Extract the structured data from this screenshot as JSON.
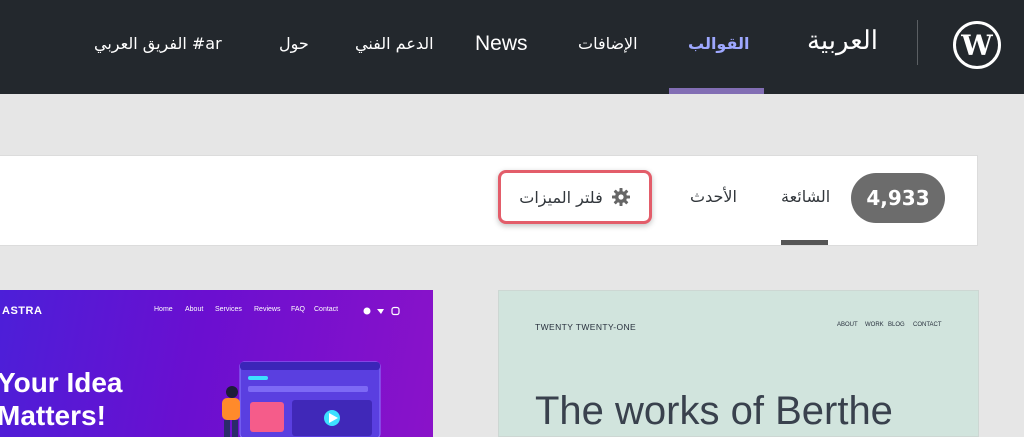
{
  "header": {
    "site_title": "العربية",
    "nav": [
      {
        "label": "القوالب",
        "active": true
      },
      {
        "label": "الإضافات"
      },
      {
        "label": "News"
      },
      {
        "label": "الدعم الفني"
      },
      {
        "label": "حول"
      },
      {
        "label": "ar# الفريق العربي"
      }
    ]
  },
  "filters": {
    "count": "4,933",
    "tabs": [
      {
        "label": "الشائعة",
        "active": true
      },
      {
        "label": "الأحدث"
      }
    ],
    "feature_filter_label": "فلتر الميزات"
  },
  "themes": {
    "astra": {
      "logo_text": "ASTRA",
      "nav": [
        "Home",
        "About",
        "Services",
        "Reviews",
        "FAQ",
        "Contact"
      ],
      "headline_line1": "Your Idea",
      "headline_line2": "Matters!"
    },
    "twenty_twenty_one": {
      "site_name": "TWENTY TWENTY-ONE",
      "nav": [
        "ABOUT",
        "WORK",
        "BLOG",
        "CONTACT"
      ],
      "headline": "The works of Berthe"
    }
  },
  "colors": {
    "header_bg": "#23282d",
    "accent": "#826eb4",
    "highlight_border": "#e35d6a"
  }
}
